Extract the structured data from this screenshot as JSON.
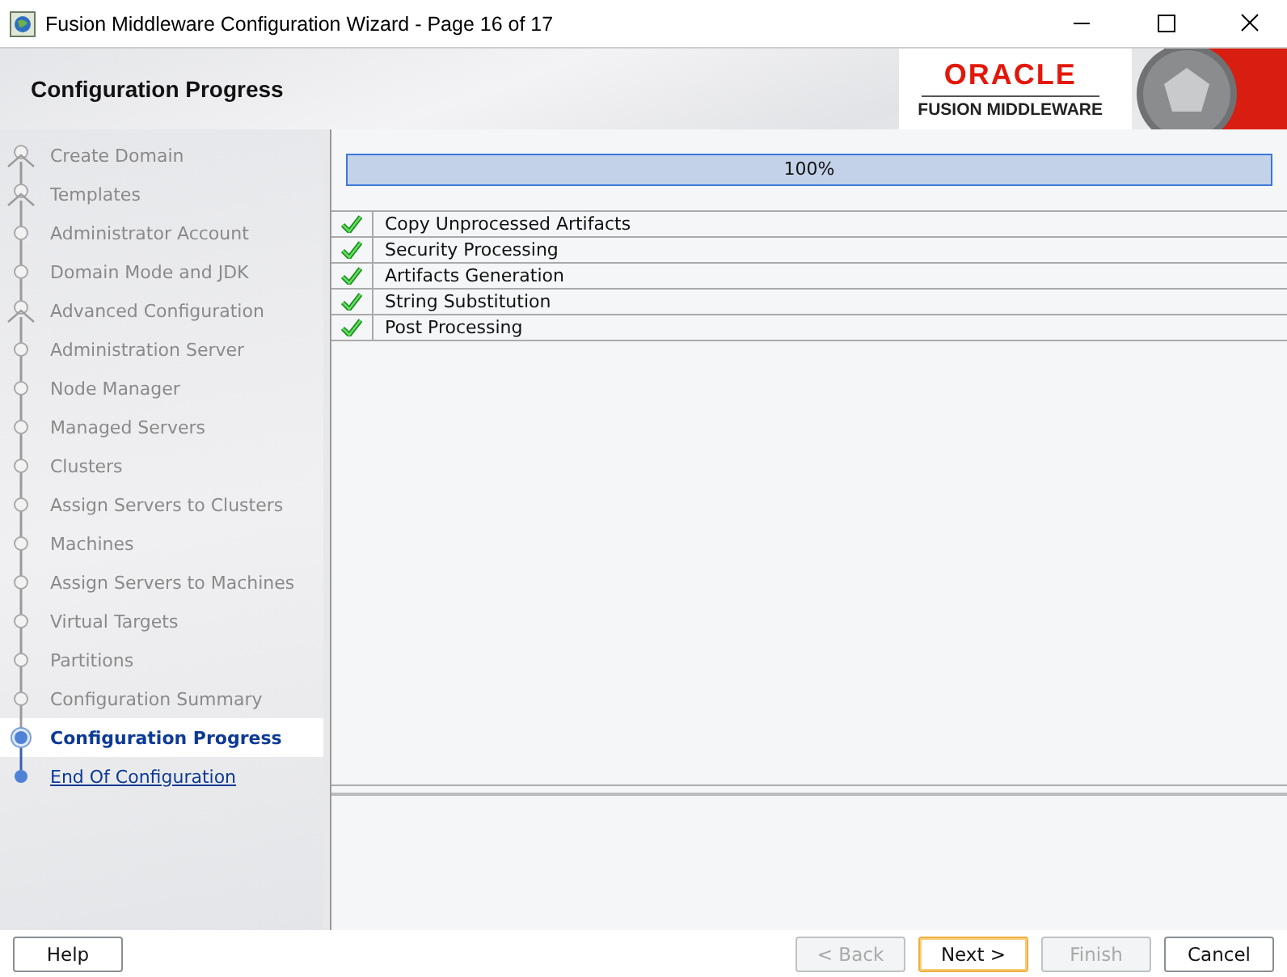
{
  "window": {
    "title": "Fusion Middleware Configuration Wizard - Page 16 of 17"
  },
  "header": {
    "title": "Configuration Progress",
    "logo_top": "ORACLE",
    "logo_bottom": "FUSION MIDDLEWARE"
  },
  "steps": [
    {
      "label": "Create Domain",
      "kind": "branch",
      "visited": true,
      "selected": false
    },
    {
      "label": "Templates",
      "kind": "branch",
      "visited": true,
      "selected": false
    },
    {
      "label": "Administrator Account",
      "kind": "step",
      "visited": true,
      "selected": false
    },
    {
      "label": "Domain Mode and JDK",
      "kind": "step",
      "visited": true,
      "selected": false
    },
    {
      "label": "Advanced Configuration",
      "kind": "branch",
      "visited": true,
      "selected": false
    },
    {
      "label": "Administration Server",
      "kind": "step",
      "visited": true,
      "selected": false
    },
    {
      "label": "Node Manager",
      "kind": "step",
      "visited": true,
      "selected": false
    },
    {
      "label": "Managed Servers",
      "kind": "step",
      "visited": true,
      "selected": false
    },
    {
      "label": "Clusters",
      "kind": "step",
      "visited": true,
      "selected": false
    },
    {
      "label": "Assign Servers to Clusters",
      "kind": "step",
      "visited": true,
      "selected": false
    },
    {
      "label": "Machines",
      "kind": "step",
      "visited": true,
      "selected": false
    },
    {
      "label": "Assign Servers to Machines",
      "kind": "step",
      "visited": true,
      "selected": false
    },
    {
      "label": "Virtual Targets",
      "kind": "step",
      "visited": true,
      "selected": false
    },
    {
      "label": "Partitions",
      "kind": "step",
      "visited": true,
      "selected": false
    },
    {
      "label": "Configuration Summary",
      "kind": "step",
      "visited": true,
      "selected": false
    },
    {
      "label": "Configuration Progress",
      "kind": "step",
      "visited": false,
      "selected": true
    },
    {
      "label": "End Of Configuration",
      "kind": "step",
      "visited": false,
      "selected": false
    }
  ],
  "progress": {
    "level": 1,
    "reading": "100%"
  },
  "tasks": [
    {
      "label": "Copy Unprocessed Artifacts",
      "done": true
    },
    {
      "label": "Security Processing",
      "done": true
    },
    {
      "label": "Artifacts Generation",
      "done": true
    },
    {
      "label": "String Substitution",
      "done": true
    },
    {
      "label": "Post Processing",
      "done": true
    }
  ],
  "buttons": [
    {
      "label": "Help",
      "disabled": false,
      "focused": false
    },
    {
      "label": "< Back",
      "disabled": true,
      "focused": false
    },
    {
      "label": "Next >",
      "disabled": false,
      "focused": true
    },
    {
      "label": "Finish",
      "disabled": true,
      "focused": false
    },
    {
      "label": "Cancel",
      "disabled": false,
      "focused": false
    }
  ]
}
